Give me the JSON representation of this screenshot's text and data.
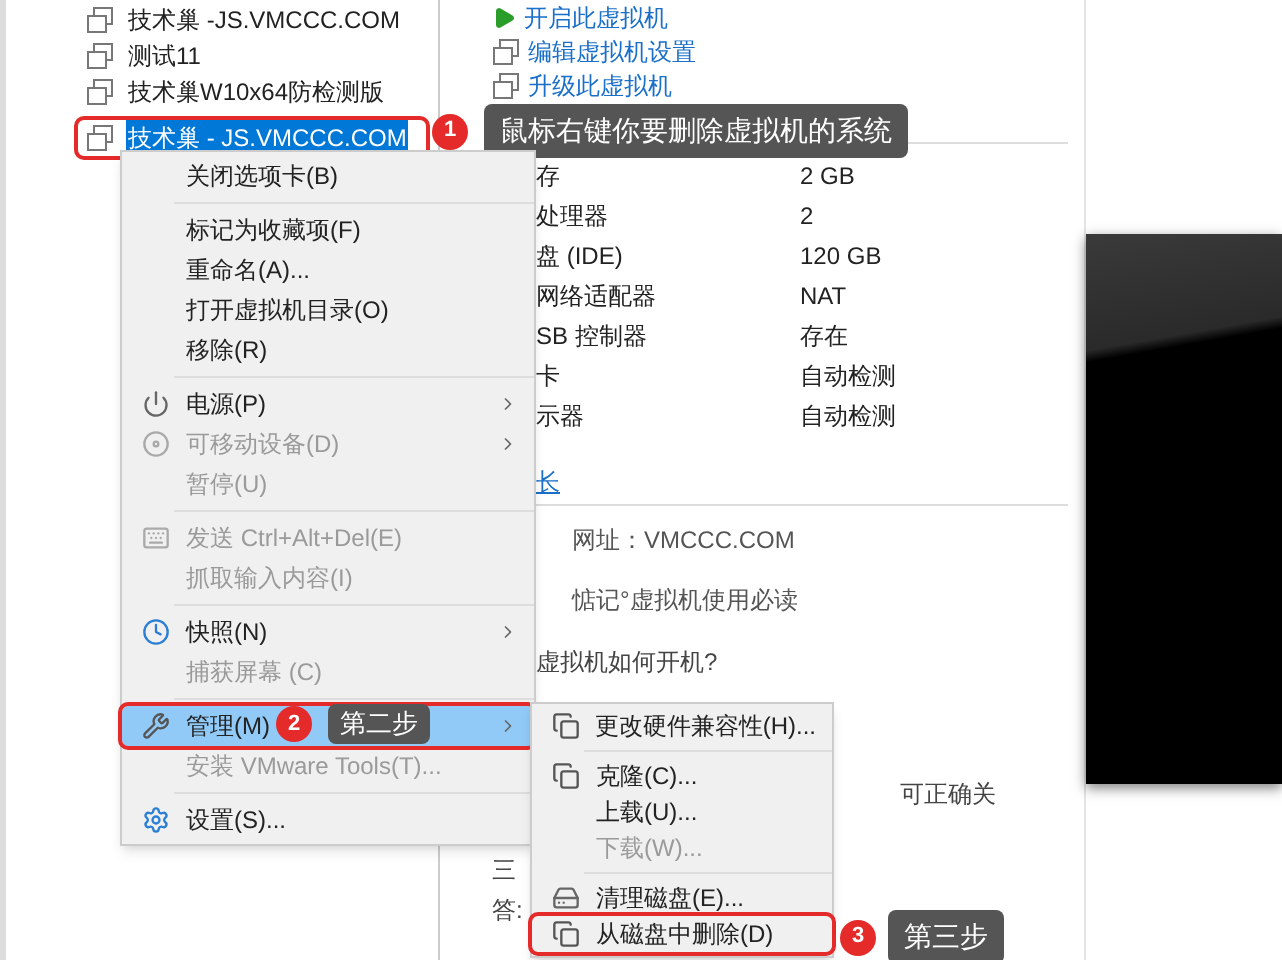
{
  "library": {
    "items": [
      {
        "label": "技术巢 -JS.VMCCC.COM",
        "selected": false,
        "annotated": false
      },
      {
        "label": "测试11",
        "selected": false,
        "annotated": false
      },
      {
        "label": "技术巢W10x64防检测版",
        "selected": false,
        "annotated": false
      },
      {
        "label": "技术巢 - JS.VMCCC.COM",
        "selected": true,
        "annotated": true
      }
    ]
  },
  "actions": [
    "开启此虚拟机",
    "编辑虚拟机设置",
    "升级此虚拟机"
  ],
  "devices": [
    {
      "name": "存",
      "value": "2 GB"
    },
    {
      "name": "处理器",
      "value": "2"
    },
    {
      "name": "盘 (IDE)",
      "value": "120 GB"
    },
    {
      "name": "网络适配器",
      "value": "NAT"
    },
    {
      "name": "SB 控制器",
      "value": "存在"
    },
    {
      "name": "卡",
      "value": "自动检测"
    },
    {
      "name": "示器",
      "value": "自动检测"
    }
  ],
  "description": {
    "link": "长",
    "lines": [
      "网址：VMCCC.COM",
      "惦记°虚拟机使用必读",
      "虚拟机如何开机?",
      "可正确关",
      "三",
      "答:"
    ]
  },
  "context_menu": [
    {
      "kind": "item",
      "label": "关闭选项卡(B)",
      "disabled": false,
      "submenu": false,
      "selected": false,
      "annotated": false
    },
    {
      "kind": "separator"
    },
    {
      "kind": "item",
      "label": "标记为收藏项(F)",
      "disabled": false,
      "submenu": false,
      "selected": false,
      "annotated": false
    },
    {
      "kind": "item",
      "label": "重命名(A)...",
      "disabled": false,
      "submenu": false,
      "selected": false,
      "annotated": false
    },
    {
      "kind": "item",
      "label": "打开虚拟机目录(O)",
      "disabled": false,
      "submenu": false,
      "selected": false,
      "annotated": false
    },
    {
      "kind": "item",
      "label": "移除(R)",
      "disabled": false,
      "submenu": false,
      "selected": false,
      "annotated": false
    },
    {
      "kind": "separator"
    },
    {
      "kind": "item",
      "label": "电源(P)",
      "disabled": false,
      "submenu": true,
      "selected": false,
      "annotated": false
    },
    {
      "kind": "item",
      "label": "可移动设备(D)",
      "disabled": true,
      "submenu": true,
      "selected": false,
      "annotated": false
    },
    {
      "kind": "item",
      "label": "暂停(U)",
      "disabled": true,
      "submenu": false,
      "selected": false,
      "annotated": false
    },
    {
      "kind": "separator"
    },
    {
      "kind": "item",
      "label": "发送 Ctrl+Alt+Del(E)",
      "disabled": true,
      "submenu": false,
      "selected": false,
      "annotated": false
    },
    {
      "kind": "item",
      "label": "抓取输入内容(I)",
      "disabled": true,
      "submenu": false,
      "selected": false,
      "annotated": false
    },
    {
      "kind": "separator"
    },
    {
      "kind": "item",
      "label": "快照(N)",
      "disabled": false,
      "submenu": true,
      "selected": false,
      "annotated": false
    },
    {
      "kind": "item",
      "label": "捕获屏幕 (C)",
      "disabled": true,
      "submenu": false,
      "selected": false,
      "annotated": false
    },
    {
      "kind": "separator"
    },
    {
      "kind": "item",
      "label": "管理(M)",
      "disabled": false,
      "submenu": true,
      "selected": true,
      "annotated": true
    },
    {
      "kind": "item",
      "label": "安装 VMware Tools(T)...",
      "disabled": true,
      "submenu": false,
      "selected": false,
      "annotated": false
    },
    {
      "kind": "separator"
    },
    {
      "kind": "item",
      "label": "设置(S)...",
      "disabled": false,
      "submenu": false,
      "selected": false,
      "annotated": false
    }
  ],
  "submenu": [
    {
      "kind": "item",
      "label": "更改硬件兼容性(H)...",
      "disabled": false,
      "annotated": false
    },
    {
      "kind": "separator"
    },
    {
      "kind": "item",
      "label": "克隆(C)...",
      "disabled": false,
      "annotated": false
    },
    {
      "kind": "item",
      "label": "上载(U)...",
      "disabled": false,
      "annotated": false
    },
    {
      "kind": "item",
      "label": "下载(W)...",
      "disabled": true,
      "annotated": false
    },
    {
      "kind": "separator"
    },
    {
      "kind": "item",
      "label": "清理磁盘(E)...",
      "disabled": false,
      "annotated": false
    },
    {
      "kind": "item",
      "label": "从磁盘中删除(D)",
      "disabled": false,
      "annotated": true
    }
  ],
  "callouts": [
    {
      "number": "1",
      "text": "鼠标右键你要删除虚拟机的系统"
    },
    {
      "number": "2",
      "text": "第二步"
    },
    {
      "number": "3",
      "text": "第三步"
    }
  ]
}
